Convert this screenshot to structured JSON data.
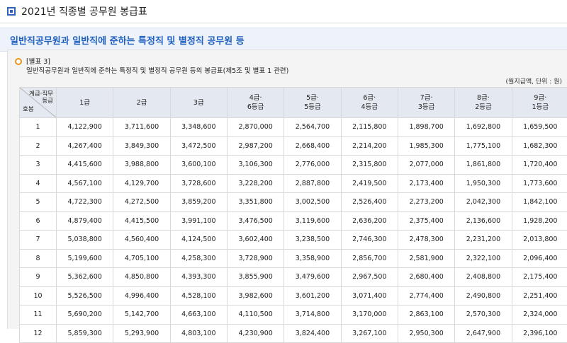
{
  "header": {
    "title": "2021년 직종별 공무원 봉급표"
  },
  "banner": {
    "text": "일반직공무원과 일반직에 준하는 특정직 및 별정직 공무원 등"
  },
  "note": {
    "label": "[별표 3]",
    "text": "일반직공무원과 일반직에 준하는 특정직 및 별정직 공무원 등의 봉급표(제5조 및 별표 1 관련)"
  },
  "unit_text": "(월지급액, 단위 : 원)",
  "table": {
    "corner_top": "계급·직무\n등급",
    "corner_bottom": "호봉",
    "columns": [
      "1급",
      "2급",
      "3급",
      "4급·\n6등급",
      "5급·\n5등급",
      "6급·\n4등급",
      "7급·\n3등급",
      "8급·\n2등급",
      "9급·\n1등급"
    ],
    "rows": [
      [
        "1",
        "4,122,900",
        "3,711,600",
        "3,348,600",
        "2,870,000",
        "2,564,700",
        "2,115,800",
        "1,898,700",
        "1,692,800",
        "1,659,500"
      ],
      [
        "2",
        "4,267,400",
        "3,849,300",
        "3,472,500",
        "2,987,200",
        "2,668,400",
        "2,214,200",
        "1,985,300",
        "1,775,100",
        "1,682,300"
      ],
      [
        "3",
        "4,415,600",
        "3,988,800",
        "3,600,100",
        "3,106,300",
        "2,776,000",
        "2,315,800",
        "2,077,000",
        "1,861,800",
        "1,720,400"
      ],
      [
        "4",
        "4,567,100",
        "4,129,700",
        "3,728,600",
        "3,228,200",
        "2,887,800",
        "2,419,500",
        "2,173,400",
        "1,950,300",
        "1,773,600"
      ],
      [
        "5",
        "4,722,300",
        "4,272,500",
        "3,859,200",
        "3,351,800",
        "3,002,500",
        "2,526,400",
        "2,273,200",
        "2,042,300",
        "1,842,100"
      ],
      [
        "6",
        "4,879,400",
        "4,415,500",
        "3,991,100",
        "3,476,500",
        "3,119,600",
        "2,636,200",
        "2,375,400",
        "2,136,600",
        "1,928,200"
      ],
      [
        "7",
        "5,038,800",
        "4,560,400",
        "4,124,500",
        "3,602,400",
        "3,238,500",
        "2,746,300",
        "2,478,300",
        "2,231,200",
        "2,013,800"
      ],
      [
        "8",
        "5,199,600",
        "4,705,100",
        "4,258,300",
        "3,728,900",
        "3,358,900",
        "2,856,700",
        "2,581,900",
        "2,322,100",
        "2,096,400"
      ],
      [
        "9",
        "5,362,600",
        "4,850,800",
        "4,393,300",
        "3,855,900",
        "3,479,600",
        "2,967,500",
        "2,680,400",
        "2,408,800",
        "2,175,400"
      ],
      [
        "10",
        "5,526,500",
        "4,996,400",
        "4,528,100",
        "3,982,600",
        "3,601,200",
        "3,071,400",
        "2,774,400",
        "2,490,800",
        "2,251,400"
      ],
      [
        "11",
        "5,690,200",
        "5,142,700",
        "4,663,100",
        "4,110,500",
        "3,714,800",
        "3,170,000",
        "2,863,100",
        "2,570,300",
        "2,324,000"
      ],
      [
        "12",
        "5,859,300",
        "5,293,900",
        "4,803,100",
        "4,230,900",
        "3,824,400",
        "3,267,100",
        "2,950,300",
        "2,647,900",
        "2,396,100"
      ]
    ]
  }
}
